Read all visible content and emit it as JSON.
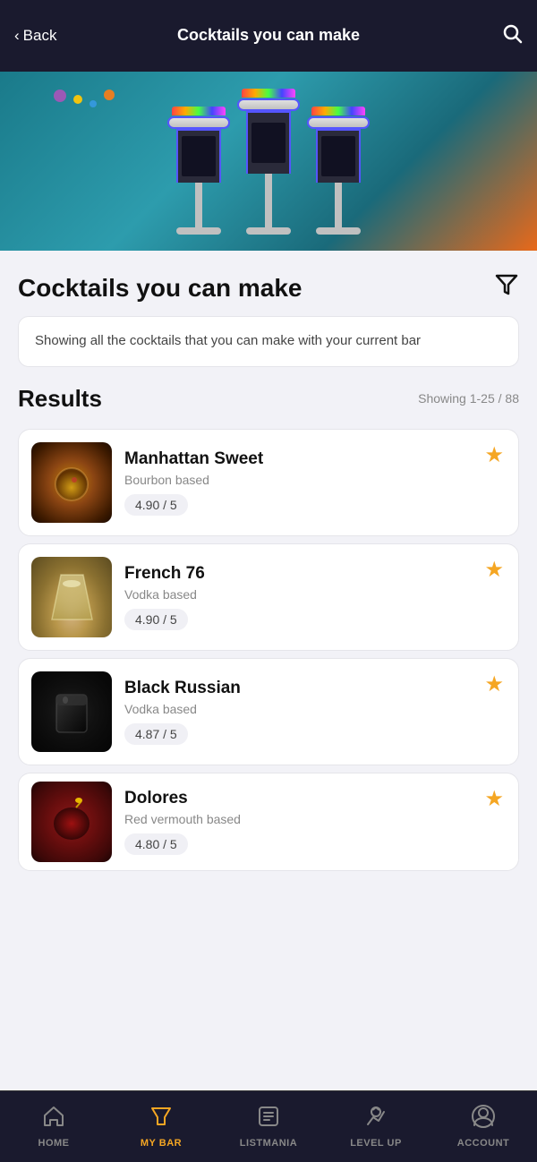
{
  "header": {
    "back_label": "Back",
    "title": "Cocktails you can make",
    "search_icon": "search"
  },
  "info": {
    "text": "Showing all the cocktails that you can make with your current bar"
  },
  "results": {
    "title": "Results",
    "count": "Showing 1-25 / 88"
  },
  "cocktails": [
    {
      "name": "Manhattan Sweet",
      "base": "Bourbon based",
      "rating": "4.90 / 5",
      "image_class": "img-manhattan",
      "glass_class": "glass-manhattan",
      "favorited": true
    },
    {
      "name": "French 76",
      "base": "Vodka based",
      "rating": "4.90 / 5",
      "image_class": "img-french76",
      "glass_class": "glass-french",
      "favorited": true
    },
    {
      "name": "Black Russian",
      "base": "Vodka based",
      "rating": "4.87 / 5",
      "image_class": "img-blackrussian",
      "glass_class": "glass-black",
      "favorited": true
    },
    {
      "name": "Dolores",
      "base": "Red vermouth based",
      "rating": "4.80 / 5",
      "image_class": "img-dolores",
      "glass_class": "glass-dolores",
      "favorited": true
    }
  ],
  "nav": {
    "items": [
      {
        "icon": "🏠",
        "label": "HOME",
        "active": false
      },
      {
        "icon": "🍸",
        "label": "MY BAR",
        "active": true
      },
      {
        "icon": "📋",
        "label": "LISTMANIA",
        "active": false
      },
      {
        "icon": "🎓",
        "label": "LEVEL UP",
        "active": false
      },
      {
        "icon": "👤",
        "label": "ACCOUNT",
        "active": false
      }
    ]
  }
}
